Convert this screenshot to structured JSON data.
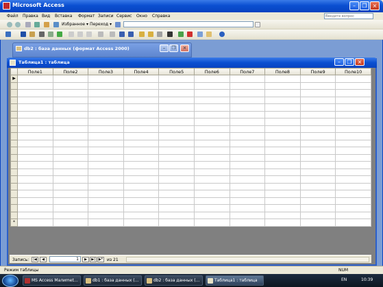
{
  "app": {
    "title": "Microsoft Access",
    "help_placeholder": "Введите вопрос"
  },
  "menu": [
    "Файл",
    "Правка",
    "Вид",
    "Вставка",
    "Формат",
    "Записи",
    "Сервис",
    "Окно",
    "Справка"
  ],
  "web_toolbar": {
    "favorites": "Избранное ▾",
    "goto": "Переход ▾"
  },
  "db_window": {
    "title": "db2 : база данных (формат Access 2000)"
  },
  "table_window": {
    "title": "Таблица1 : таблица",
    "columns": [
      "Поле1",
      "Поле2",
      "Поле3",
      "Поле4",
      "Поле5",
      "Поле6",
      "Поле7",
      "Поле8",
      "Поле9",
      "Поле10"
    ],
    "current_marker": "▶",
    "new_marker": "*",
    "empty_rows": 20
  },
  "record_nav": {
    "label": "Запись:",
    "current": "1",
    "of_label": "из 21",
    "first": "|◀",
    "prev": "◀",
    "next": "▶",
    "last": "▶|",
    "new": "▶*"
  },
  "status": {
    "text": "Режим таблицы",
    "num": "NUM"
  },
  "taskbar": {
    "items": [
      {
        "label": "MS Access Малиmet…",
        "color": "#b03030"
      },
      {
        "label": "db1 : база данных (…",
        "color": "#d8c080"
      },
      {
        "label": "db2 : база данных (…",
        "color": "#d8c080"
      },
      {
        "label": "Таблица1 : таблица",
        "color": "#e7e2c6"
      }
    ],
    "lang": "EN",
    "time": "10:39"
  }
}
